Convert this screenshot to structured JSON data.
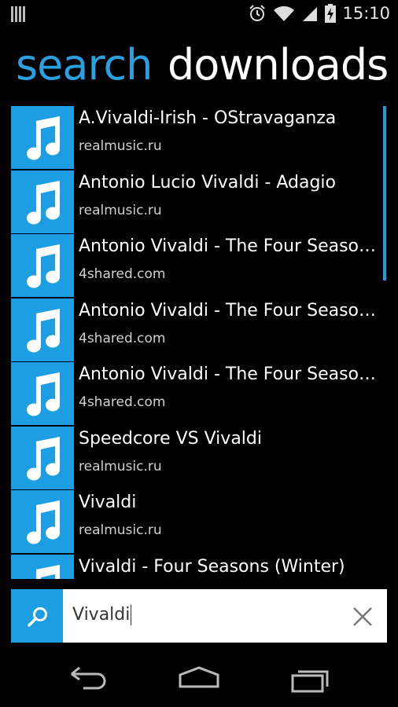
{
  "status_bar": {
    "time": "15:10",
    "icons": [
      "signal-bars-icon",
      "alarm-icon",
      "wifi-icon",
      "cell-signal-icon",
      "battery-charging-icon"
    ]
  },
  "tabs": [
    {
      "label": "search",
      "active": true
    },
    {
      "label": "downloads",
      "active": false
    }
  ],
  "results": [
    {
      "title": "A.Vivaldi-Irish - OStravaganza",
      "source": "realmusic.ru"
    },
    {
      "title": "Antonio Lucio Vivaldi - Adagio",
      "source": "realmusic.ru"
    },
    {
      "title": "Antonio Vivaldi - The Four Seasons - Spring",
      "source": "4shared.com"
    },
    {
      "title": "Antonio Vivaldi - The Four Seasons - Summer",
      "source": "4shared.com"
    },
    {
      "title": "Antonio Vivaldi - The Four Seasons - Autumn",
      "source": "4shared.com"
    },
    {
      "title": "Speedcore VS Vivaldi",
      "source": "realmusic.ru"
    },
    {
      "title": "Vivaldi",
      "source": "realmusic.ru"
    },
    {
      "title": "Vivaldi - Four Seasons (Winter)",
      "source": ""
    }
  ],
  "search": {
    "value": "Vivaldi",
    "placeholder": ""
  },
  "colors": {
    "accent": "#1e9ee2",
    "background": "#000000"
  }
}
